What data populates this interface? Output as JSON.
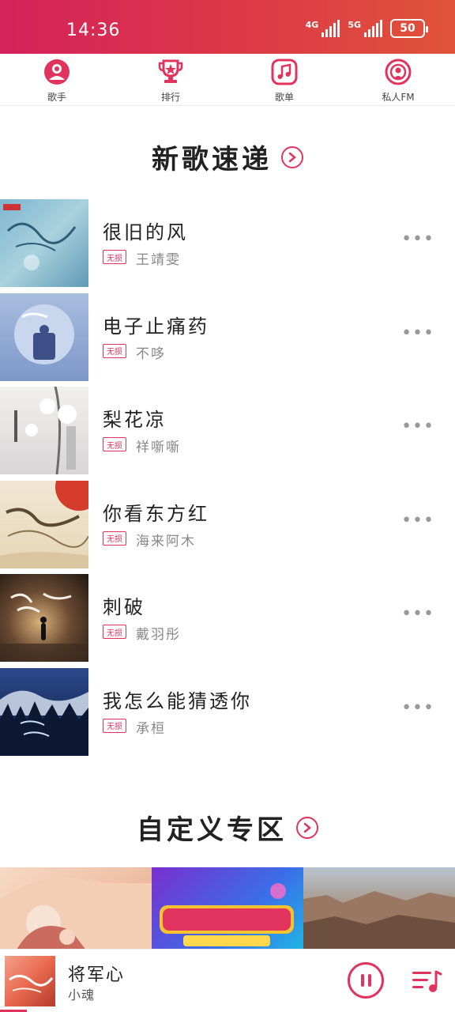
{
  "status_bar": {
    "time": "14:36",
    "network_1": "4G",
    "network_2": "5G",
    "battery": "50"
  },
  "nav": {
    "items": [
      {
        "label": "歌手",
        "icon": "singer-icon"
      },
      {
        "label": "排行",
        "icon": "trophy-icon"
      },
      {
        "label": "歌单",
        "icon": "music-note-icon"
      },
      {
        "label": "私人FM",
        "icon": "radio-icon"
      }
    ]
  },
  "new_songs": {
    "title": "新歌速递",
    "badge_label": "无损",
    "songs": [
      {
        "title": "很旧的风",
        "artist": "王靖雯"
      },
      {
        "title": "电子止痛药",
        "artist": "不哆"
      },
      {
        "title": "梨花凉",
        "artist": "祥噺噺"
      },
      {
        "title": "你看东方红",
        "artist": "海来阿木"
      },
      {
        "title": "刺破",
        "artist": "戴羽彤"
      },
      {
        "title": "我怎么能猜透你",
        "artist": "承桓"
      }
    ]
  },
  "custom_zone": {
    "title": "自定义专区"
  },
  "player": {
    "title": "将军心",
    "artist": "小魂"
  },
  "colors": {
    "accent": "#e0345f",
    "status_bar_start": "#d4225b",
    "status_bar_end": "#e0533a"
  }
}
